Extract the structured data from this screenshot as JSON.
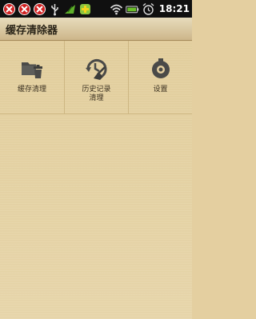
{
  "status_bar": {
    "time": "18:21",
    "icons": [
      "alert-icon",
      "alert-icon",
      "alert-icon",
      "usb-icon",
      "battery-charge-icon",
      "app-icon",
      "wifi-icon",
      "battery-icon",
      "alarm-icon"
    ]
  },
  "title_bar": {
    "title": "缓存清除器"
  },
  "menu": {
    "items": [
      {
        "label": "缓存清理",
        "icon": "folder-trash-icon"
      },
      {
        "label": "历史记录\n清理",
        "icon": "history-broom-icon"
      },
      {
        "label": "设置",
        "icon": "settings-icon"
      }
    ]
  }
}
